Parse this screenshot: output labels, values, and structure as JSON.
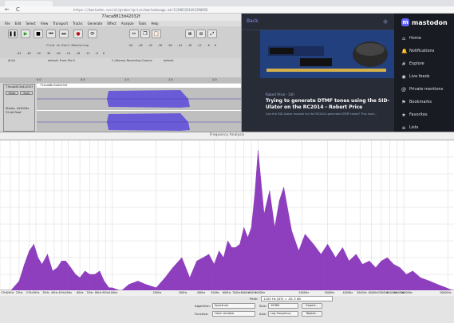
{
  "browser": {
    "url": "https://mastodon.social/@robertprice/mastodonapp.uk/113883261461390656",
    "back": "←",
    "reload": "C"
  },
  "audacity": {
    "window_title": "7?eca8813d42032f",
    "menu": [
      "File",
      "Edit",
      "Select",
      "View",
      "Transport",
      "Tracks",
      "Generate",
      "Effect",
      "Analyze",
      "Tools",
      "Help"
    ],
    "monitor_text": "Click to Start Monitoring",
    "meter_scale": [
      "-54",
      "-48",
      "-42",
      "-36",
      "-30",
      "-24",
      "-18",
      "-12",
      "-6",
      "0"
    ],
    "host": "ALSA",
    "output_device": "default: Front Mic:0",
    "channels": "2 (Stereo) Recording Channe",
    "input_device": "default",
    "ruler": [
      "0.0",
      "0.5",
      "1.0",
      "1.5",
      "2.0"
    ],
    "track_name": "7?eca8813d42032f",
    "clip_name": "77eca8813d42032f",
    "mute": "Mute",
    "solo": "Solo",
    "track_info": [
      "Stereo, 44100Hz",
      "32-bit float"
    ]
  },
  "mastodon": {
    "back_label": "Back",
    "brand": "mastodon",
    "post_meta": "Robert Price · 14h",
    "post_title": "Trying to generate DTMF tones using the SID-Ulator on the RC2014 - Robert Price",
    "post_desc": "Can the SID-Ulator module for the RC2014 generate DTMF tones? This mod...",
    "nav": [
      {
        "icon": "⌂",
        "label": "Home"
      },
      {
        "icon": "🔔",
        "label": "Notifications"
      },
      {
        "icon": "#",
        "label": "Explore"
      },
      {
        "icon": "◉",
        "label": "Live feeds"
      },
      {
        "icon": "@",
        "label": "Private mentions"
      },
      {
        "icon": "⚑",
        "label": "Bookmarks"
      },
      {
        "icon": "★",
        "label": "Favorites"
      },
      {
        "icon": "≡",
        "label": "Lists"
      }
    ]
  },
  "freq": {
    "title": "Frequency Analysis",
    "peak_label": "Peak:",
    "peak_value": "1200 Hz (D5) = -61.3 dB",
    "algorithm_label": "Algorithm:",
    "algorithm": "Spectrum",
    "size_label": "Size:",
    "size": "16384",
    "export": "Export...",
    "function_label": "Function:",
    "function": "Hann window",
    "axis_label": "Axis:",
    "axis": "Log frequency",
    "replot": "Replot..."
  },
  "chart_data": {
    "type": "area",
    "x_scale": "log",
    "x_range_hz": [
      17,
      22050
    ],
    "y_range_db": [
      -93,
      -48
    ],
    "grid": true,
    "color": "#8e3fbd",
    "x_tick_labels": [
      "17Hz",
      "20Hz",
      "23Hz",
      "27Hz",
      "30Hz",
      "35Hz",
      "40Hz",
      "45Hz",
      "50Hz",
      "60Hz",
      "70Hz",
      "80Hz",
      "90Hz",
      "100Hz",
      "200Hz",
      "300Hz",
      "400Hz",
      "500Hz",
      "600Hz",
      "700Hz",
      "800Hz",
      "900Hz",
      "1000Hz",
      "2000Hz",
      "3000Hz",
      "4000Hz",
      "5000Hz",
      "6000Hz",
      "7000Hz",
      "8000Hz",
      "9000Hz",
      "10000Hz",
      "20000Hz"
    ],
    "x_tick_values": [
      17,
      20,
      23,
      27,
      30,
      35,
      40,
      45,
      50,
      60,
      70,
      80,
      90,
      100,
      200,
      300,
      400,
      500,
      600,
      700,
      800,
      900,
      1000,
      2000,
      3000,
      4000,
      5000,
      6000,
      7000,
      8000,
      9000,
      10000,
      20000
    ],
    "series": [
      {
        "freq_hz": [
          17,
          20,
          23,
          25,
          27,
          29,
          31,
          33,
          36,
          39,
          42,
          45,
          48,
          52,
          56,
          60,
          65,
          70,
          76,
          82,
          88,
          95,
          100,
          115,
          130,
          150,
          170,
          200,
          230,
          260,
          300,
          340,
          380,
          420,
          460,
          500,
          540,
          580,
          620,
          660,
          700,
          750,
          800,
          850,
          900,
          950,
          1000,
          1100,
          1200,
          1300,
          1400,
          1500,
          1700,
          1900,
          2100,
          2400,
          2700,
          3000,
          3400,
          3800,
          4200,
          4700,
          5200,
          5800,
          6400,
          7000,
          7700,
          8500,
          9400,
          10400,
          11500,
          13000,
          15000,
          17000,
          19500,
          22050
        ],
        "level_db": [
          -93,
          -93,
          -90,
          -85,
          -81,
          -79,
          -83,
          -85,
          -82,
          -87,
          -86,
          -84,
          -84,
          -86,
          -88,
          -89,
          -87,
          -88,
          -88,
          -87,
          -90,
          -92,
          -92,
          -93,
          -91,
          -90,
          -91,
          -92,
          -89,
          -86,
          -83,
          -89,
          -84,
          -83,
          -82,
          -85,
          -81,
          -83,
          -78,
          -80,
          -80,
          -79,
          -74,
          -77,
          -74,
          -64,
          -51,
          -70,
          -63,
          -74,
          -66,
          -62,
          -75,
          -81,
          -76,
          -79,
          -82,
          -79,
          -83,
          -80,
          -84,
          -82,
          -85,
          -84,
          -86,
          -84,
          -83,
          -85,
          -86,
          -88,
          -87,
          -89,
          -90,
          -91,
          -92,
          -93
        ]
      }
    ]
  }
}
